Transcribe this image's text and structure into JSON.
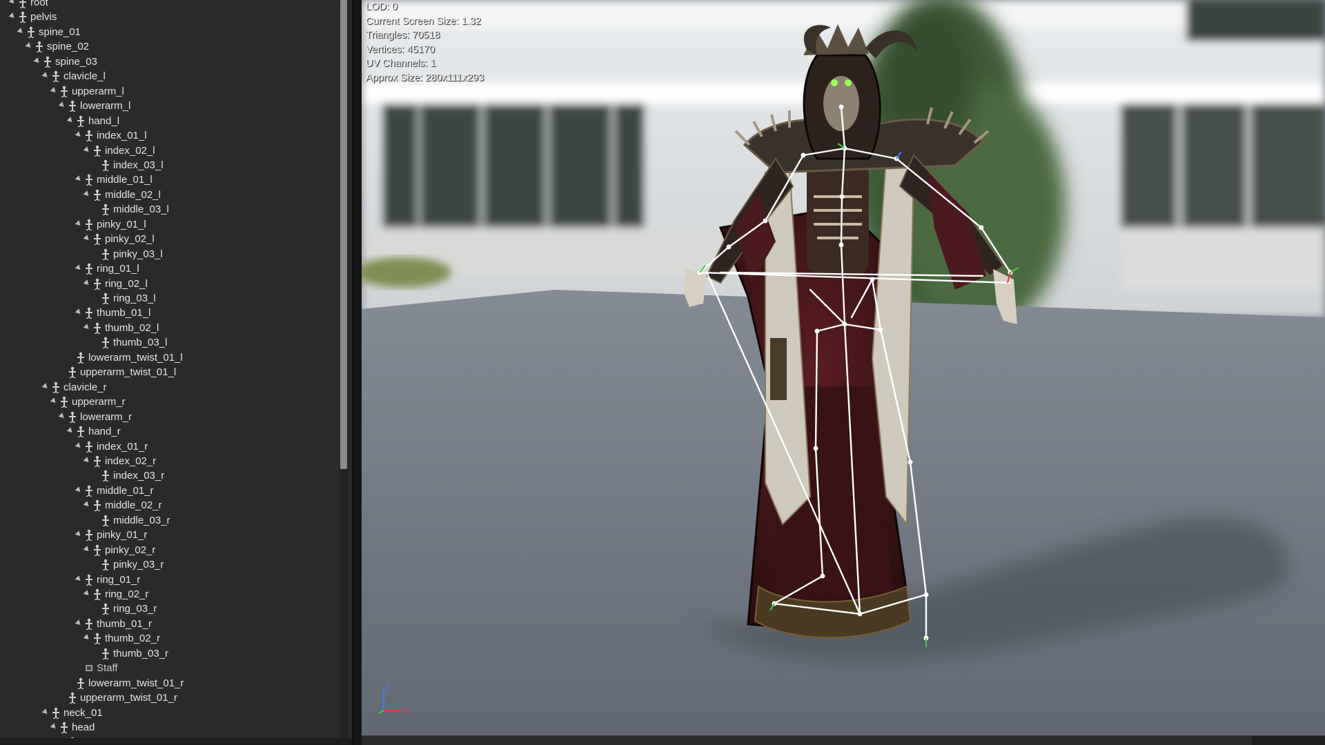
{
  "skeleton_tree": {
    "items": [
      {
        "label": "root",
        "depth": 1,
        "expanded": true
      },
      {
        "label": "pelvis",
        "depth": 1,
        "expanded": true
      },
      {
        "label": "spine_01",
        "depth": 2,
        "expanded": true
      },
      {
        "label": "spine_02",
        "depth": 3,
        "expanded": true
      },
      {
        "label": "spine_03",
        "depth": 4,
        "expanded": true
      },
      {
        "label": "clavicle_l",
        "depth": 5,
        "expanded": true
      },
      {
        "label": "upperarm_l",
        "depth": 6,
        "expanded": true
      },
      {
        "label": "lowerarm_l",
        "depth": 7,
        "expanded": true
      },
      {
        "label": "hand_l",
        "depth": 8,
        "expanded": true
      },
      {
        "label": "index_01_l",
        "depth": 9,
        "expanded": true
      },
      {
        "label": "index_02_l",
        "depth": 10,
        "expanded": true
      },
      {
        "label": "index_03_l",
        "depth": 11,
        "expanded": false
      },
      {
        "label": "middle_01_l",
        "depth": 9,
        "expanded": true
      },
      {
        "label": "middle_02_l",
        "depth": 10,
        "expanded": true
      },
      {
        "label": "middle_03_l",
        "depth": 11,
        "expanded": false
      },
      {
        "label": "pinky_01_l",
        "depth": 9,
        "expanded": true
      },
      {
        "label": "pinky_02_l",
        "depth": 10,
        "expanded": true
      },
      {
        "label": "pinky_03_l",
        "depth": 11,
        "expanded": false
      },
      {
        "label": "ring_01_l",
        "depth": 9,
        "expanded": true
      },
      {
        "label": "ring_02_l",
        "depth": 10,
        "expanded": true
      },
      {
        "label": "ring_03_l",
        "depth": 11,
        "expanded": false
      },
      {
        "label": "thumb_01_l",
        "depth": 9,
        "expanded": true
      },
      {
        "label": "thumb_02_l",
        "depth": 10,
        "expanded": true
      },
      {
        "label": "thumb_03_l",
        "depth": 11,
        "expanded": false
      },
      {
        "label": "lowerarm_twist_01_l",
        "depth": 8,
        "expanded": false
      },
      {
        "label": "upperarm_twist_01_l",
        "depth": 7,
        "expanded": false
      },
      {
        "label": "clavicle_r",
        "depth": 5,
        "expanded": true
      },
      {
        "label": "upperarm_r",
        "depth": 6,
        "expanded": true
      },
      {
        "label": "lowerarm_r",
        "depth": 7,
        "expanded": true
      },
      {
        "label": "hand_r",
        "depth": 8,
        "expanded": true
      },
      {
        "label": "index_01_r",
        "depth": 9,
        "expanded": true
      },
      {
        "label": "index_02_r",
        "depth": 10,
        "expanded": true
      },
      {
        "label": "index_03_r",
        "depth": 11,
        "expanded": false
      },
      {
        "label": "middle_01_r",
        "depth": 9,
        "expanded": true
      },
      {
        "label": "middle_02_r",
        "depth": 10,
        "expanded": true
      },
      {
        "label": "middle_03_r",
        "depth": 11,
        "expanded": false
      },
      {
        "label": "pinky_01_r",
        "depth": 9,
        "expanded": true
      },
      {
        "label": "pinky_02_r",
        "depth": 10,
        "expanded": true
      },
      {
        "label": "pinky_03_r",
        "depth": 11,
        "expanded": false
      },
      {
        "label": "ring_01_r",
        "depth": 9,
        "expanded": true
      },
      {
        "label": "ring_02_r",
        "depth": 10,
        "expanded": true
      },
      {
        "label": "ring_03_r",
        "depth": 11,
        "expanded": false
      },
      {
        "label": "thumb_01_r",
        "depth": 9,
        "expanded": true
      },
      {
        "label": "thumb_02_r",
        "depth": 10,
        "expanded": true
      },
      {
        "label": "thumb_03_r",
        "depth": 11,
        "expanded": false
      },
      {
        "label": "Staff",
        "depth": 9,
        "expanded": false,
        "kind": "socket"
      },
      {
        "label": "lowerarm_twist_01_r",
        "depth": 8,
        "expanded": false
      },
      {
        "label": "upperarm_twist_01_r",
        "depth": 7,
        "expanded": false
      },
      {
        "label": "neck_01",
        "depth": 5,
        "expanded": true
      },
      {
        "label": "head",
        "depth": 6,
        "expanded": true
      },
      {
        "label": "Jaw",
        "depth": 7,
        "expanded": false
      }
    ]
  },
  "viewport": {
    "stats": {
      "lod": "LOD: 0",
      "screen_size": "Current Screen Size: 1.32",
      "triangles": "Triangles: 70518",
      "vertices": "Vertices: 45170",
      "uv_channels": "UV Channels: 1",
      "approx_size": "Approx Size: 280x111x293"
    },
    "axis_gizmo": {
      "z_label": "Z",
      "x_label": "X",
      "z_color": "#3c7dff",
      "x_color": "#e23a3a",
      "y_color": "#3bd13b"
    }
  },
  "colors": {
    "panel_bg": "#2a2a2a",
    "text": "#e6e6e6",
    "bone_lines": "#ffffff",
    "floor": "#707884",
    "sky": "#d5d9dd"
  }
}
